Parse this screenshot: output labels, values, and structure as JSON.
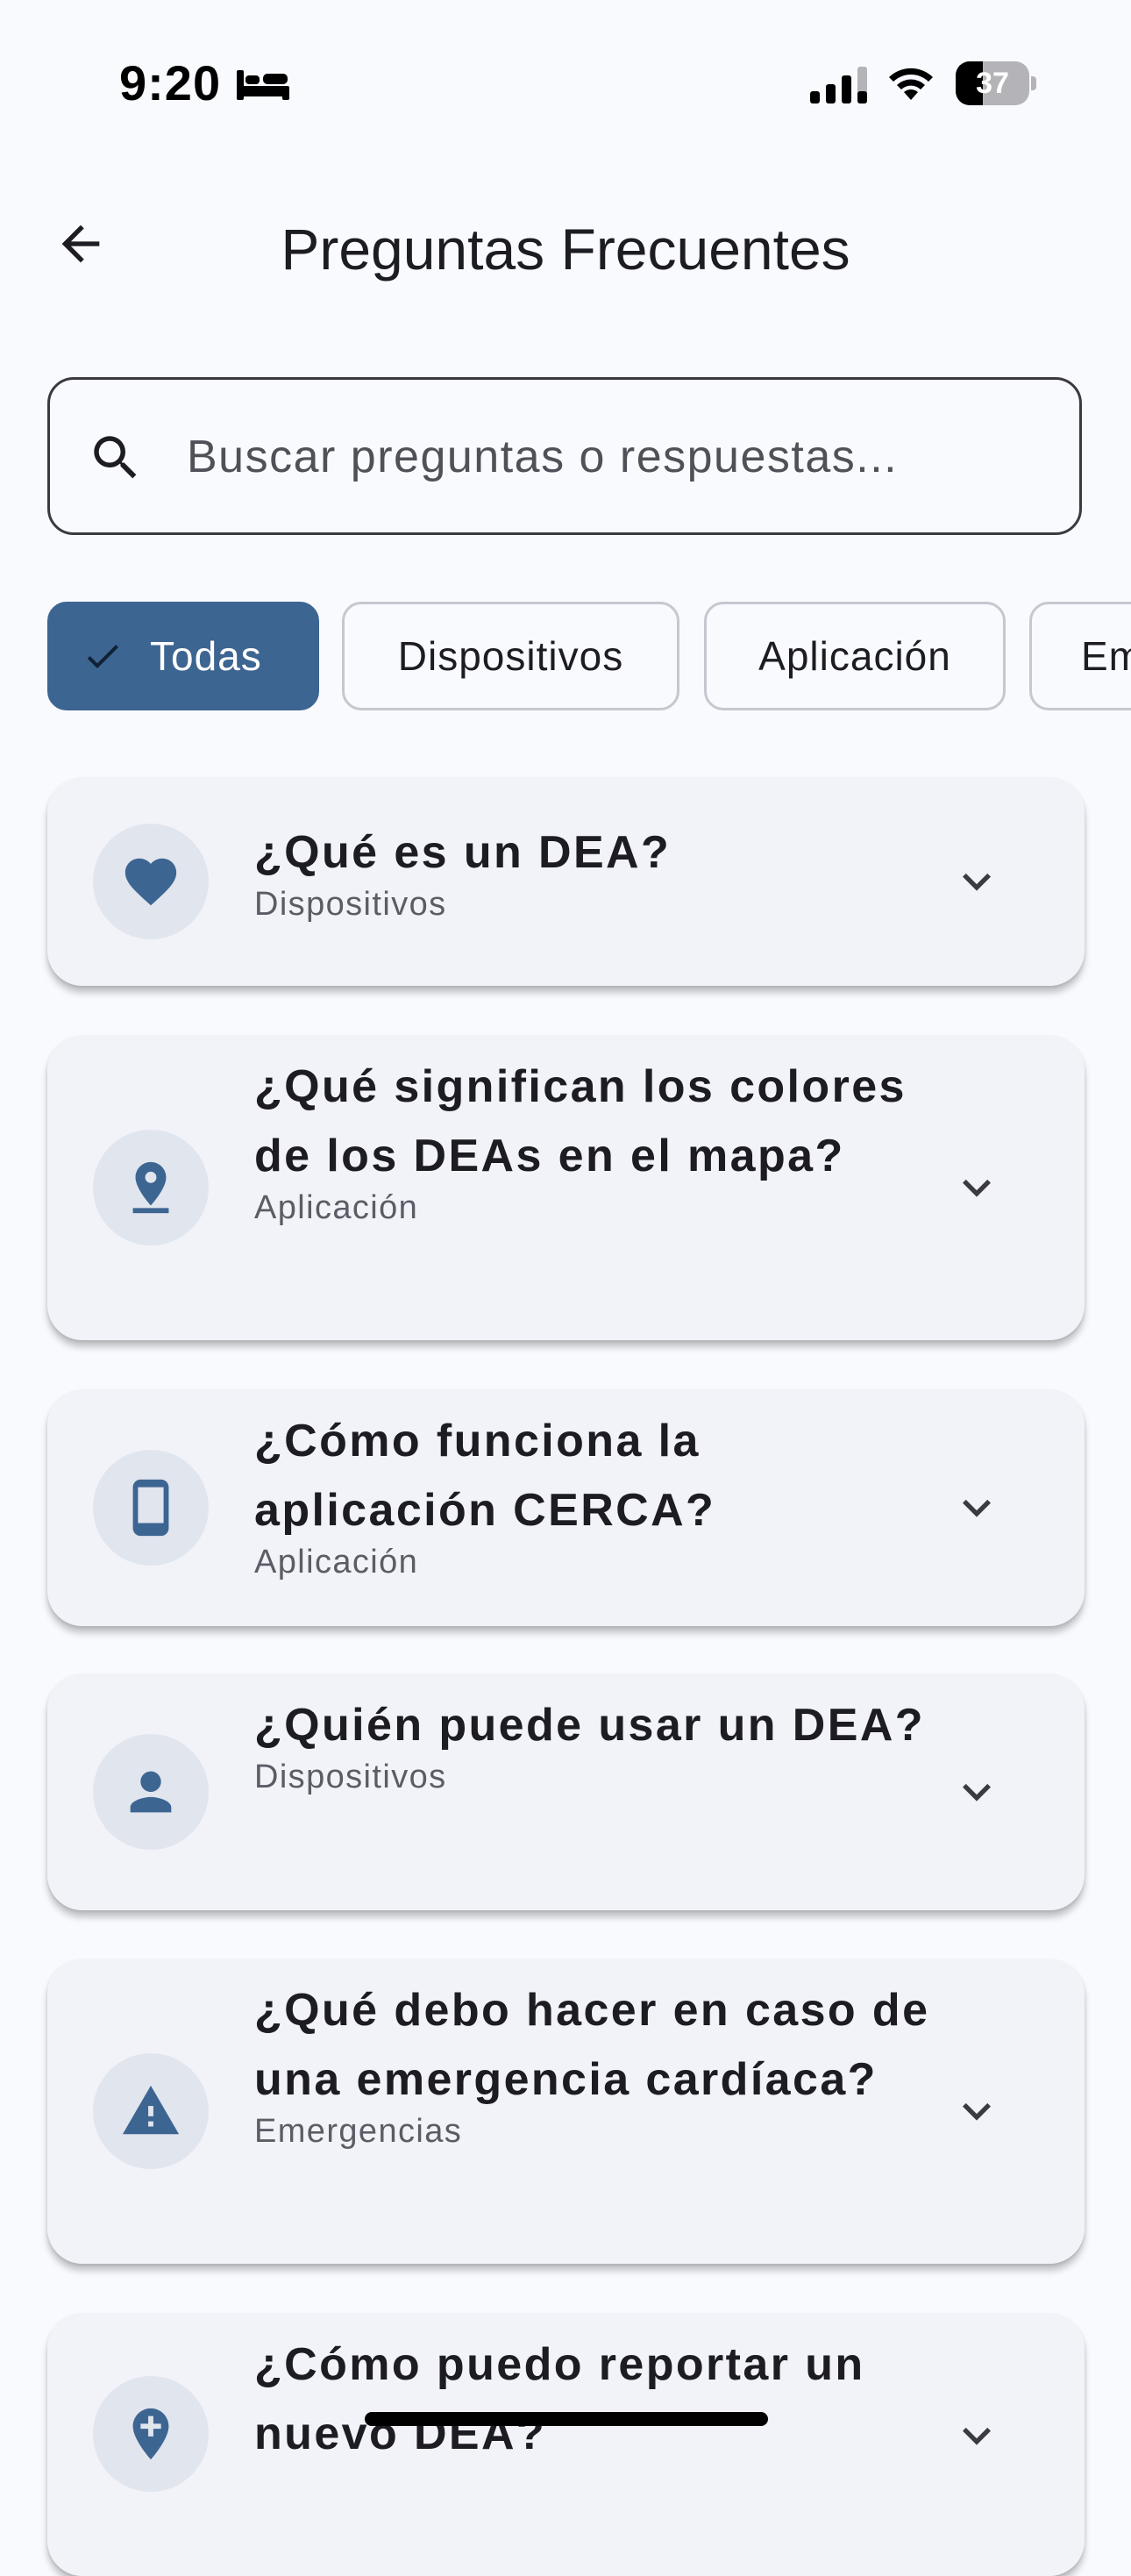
{
  "status_bar": {
    "time": "9:20",
    "battery": "37",
    "focus_icon": "bed-icon",
    "signal_icon": "cellular-signal-icon",
    "wifi_icon": "wifi-icon"
  },
  "header": {
    "title": "Preguntas Frecuentes",
    "back_icon": "arrow-back-icon"
  },
  "search": {
    "placeholder": "Buscar preguntas o respuestas...",
    "value": "",
    "icon": "search-icon"
  },
  "filters": {
    "chips": [
      {
        "label": "Todas",
        "selected": true
      },
      {
        "label": "Dispositivos",
        "selected": false
      },
      {
        "label": "Aplicación",
        "selected": false
      },
      {
        "label": "Em",
        "selected": false
      }
    ],
    "selected_color": "#3d6592"
  },
  "faqs": [
    {
      "question": "¿Qué es un DEA?",
      "category": "Dispositivos",
      "icon": "heart-icon"
    },
    {
      "question": "¿Qué significan los colores de los DEAs en el mapa?",
      "category": "Aplicación",
      "icon": "location-pin-icon"
    },
    {
      "question": "¿Cómo funciona la aplicación CERCA?",
      "category": "Aplicación",
      "icon": "phone-icon"
    },
    {
      "question": "¿Quién puede usar un DEA?",
      "category": "Dispositivos",
      "icon": "person-icon"
    },
    {
      "question": "¿Qué debo hacer en caso de una emergencia cardíaca?",
      "category": "Emergencias",
      "icon": "warning-icon"
    },
    {
      "question": "¿Cómo puedo reportar un nuevo DEA?",
      "category": "",
      "icon": "add-location-icon"
    }
  ],
  "colors": {
    "accent": "#3d6592",
    "background": "#f9fafe",
    "card": "#f2f3f9",
    "avatar": "#e1e5ee"
  }
}
